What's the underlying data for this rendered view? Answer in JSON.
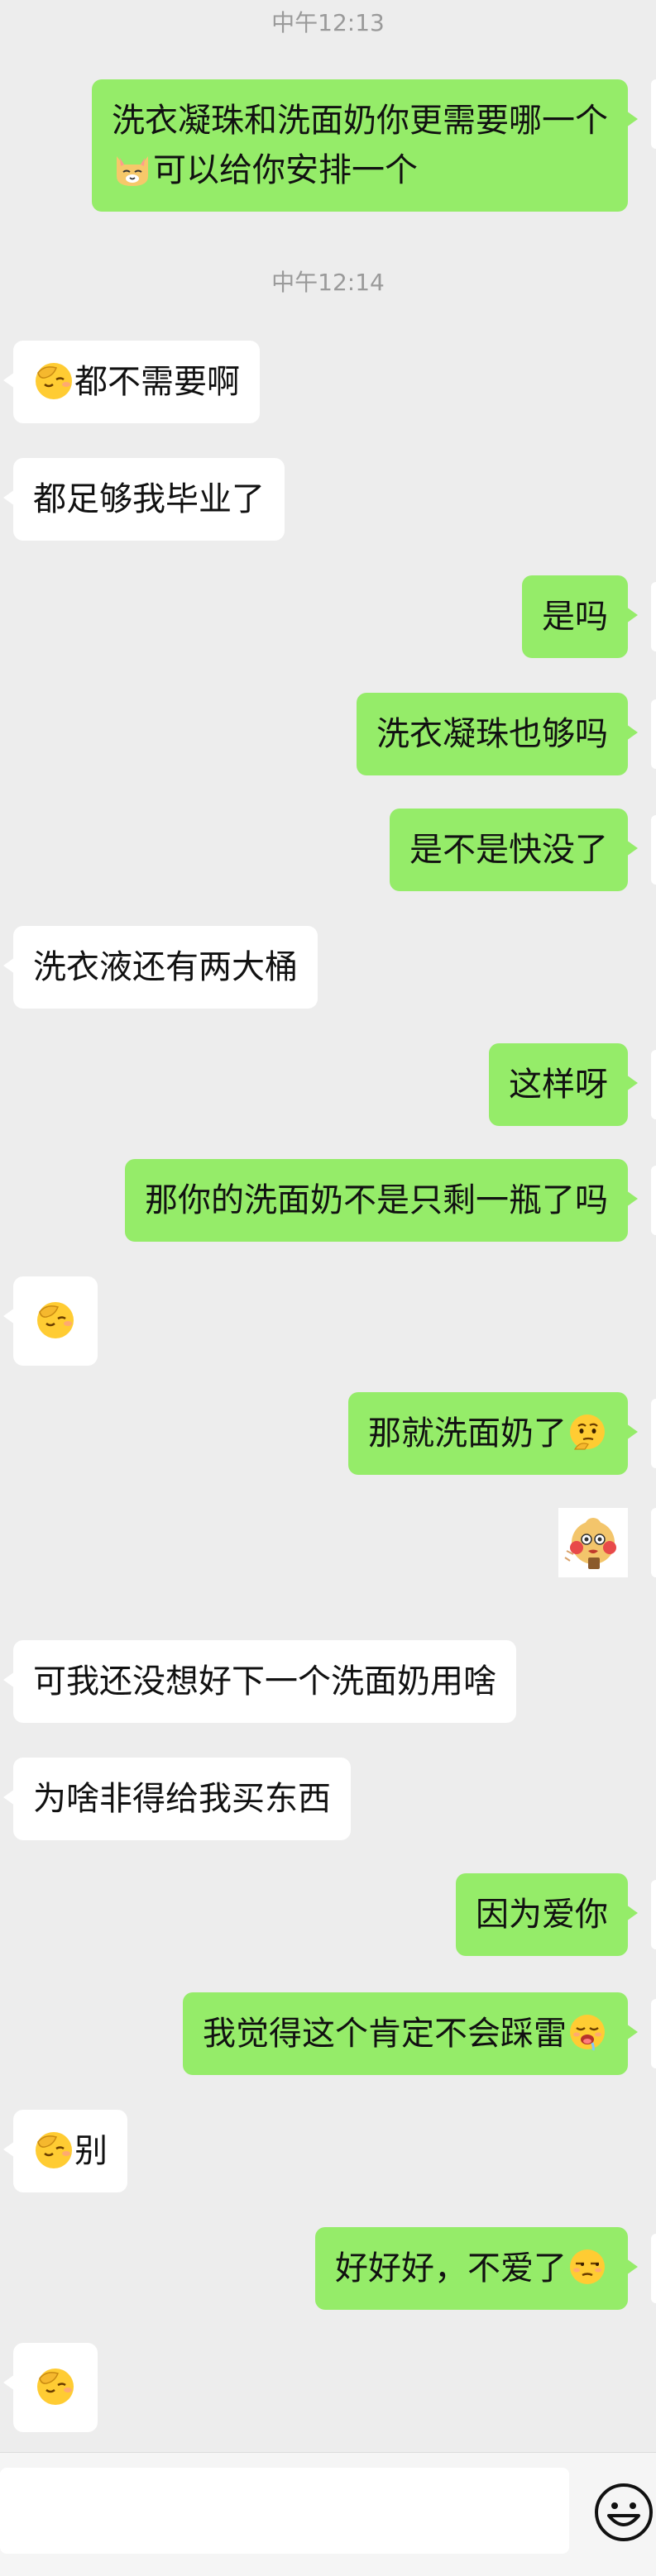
{
  "timestamps": [
    "中午12:13",
    "中午12:14"
  ],
  "messages": [
    {
      "sender": "me",
      "text": "洗衣凝珠和洗面奶你更需要哪一个",
      "text2": "可以给你安排一个",
      "emoji": "cat-face-emoji"
    },
    {
      "sender": "them",
      "text": "都不需要啊",
      "emoji": "facepalm-emoji"
    },
    {
      "sender": "them",
      "text": "都足够我毕业了"
    },
    {
      "sender": "me",
      "text": "是吗"
    },
    {
      "sender": "me",
      "text": "洗衣凝珠也够吗"
    },
    {
      "sender": "me",
      "text": "是不是快没了"
    },
    {
      "sender": "them",
      "text": "洗衣液还有两大桶"
    },
    {
      "sender": "me",
      "text": "这样呀"
    },
    {
      "sender": "me",
      "text": "那你的洗面奶不是只剩一瓶了吗"
    },
    {
      "sender": "them",
      "text": "",
      "emoji": "facepalm-emoji"
    },
    {
      "sender": "me",
      "text": "那就洗面奶了",
      "emoji": "thinking-emoji"
    },
    {
      "sender": "me",
      "sticker": "chick-sticker"
    },
    {
      "sender": "them",
      "text": "可我还没想好下一个洗面奶用啥"
    },
    {
      "sender": "them",
      "text": "为啥非得给我买东西"
    },
    {
      "sender": "me",
      "text": "因为爱你"
    },
    {
      "sender": "me",
      "text": "我觉得这个肯定不会踩雷",
      "emoji": "drooling-emoji"
    },
    {
      "sender": "them",
      "text": "别",
      "emoji": "facepalm-emoji"
    },
    {
      "sender": "me",
      "text": "好好好，不爱了",
      "emoji": "unamused-emoji"
    },
    {
      "sender": "them",
      "text": "",
      "emoji": "facepalm-emoji"
    }
  ],
  "input_bar": {
    "placeholder": "",
    "emoji_button": "smiley-icon"
  },
  "colors": {
    "sent_bubble": "#95ec69",
    "received_bubble": "#ffffff",
    "background": "#ededed"
  }
}
